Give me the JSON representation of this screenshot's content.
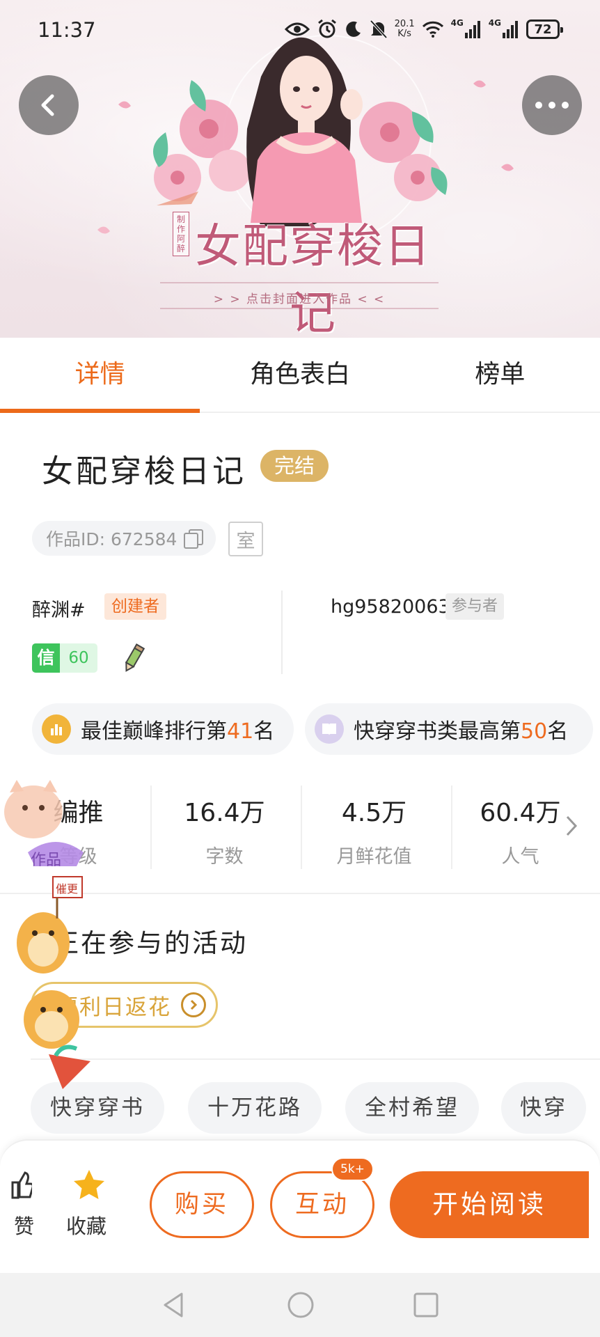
{
  "status_bar": {
    "time": "11:37",
    "net_speed_value": "20.1",
    "net_speed_unit": "K/s",
    "network_label_1": "4G",
    "network_label_2": "4G",
    "battery": "72"
  },
  "hero": {
    "title": "女配穿梭日记",
    "credit": "制作 阿醉",
    "hint": "> > 点击封面进入作品 < <"
  },
  "tabs": [
    {
      "label": "详情",
      "active": true
    },
    {
      "label": "角色表白",
      "active": false
    },
    {
      "label": "榜单",
      "active": false
    }
  ],
  "book": {
    "title": "女配穿梭日记",
    "status": "完结",
    "id_label": "作品ID: 672584",
    "room_label": "室"
  },
  "authors": {
    "creator_name": "醉渊#",
    "creator_tag": "创建者",
    "credit_label": "信",
    "credit_value": "60",
    "participant_name": "hg95820063",
    "participant_tag": "参与者"
  },
  "rankings": [
    {
      "prefix": "最佳巅峰排行第",
      "number": "41",
      "suffix": "名"
    },
    {
      "prefix": "快穿穿书类最高第",
      "number": "50",
      "suffix": "名"
    }
  ],
  "stats": [
    {
      "value": "编推",
      "label": "等级"
    },
    {
      "value": "16.4万",
      "label": "字数"
    },
    {
      "value": "4.5万",
      "label": "月鲜花值"
    },
    {
      "value": "60.4万",
      "label": "人气"
    }
  ],
  "activities": {
    "title": "正在参与的活动",
    "items": [
      "福利日返花"
    ]
  },
  "tags": [
    "快穿穿书",
    "十万花路",
    "全村希望",
    "快穿"
  ],
  "float_deco": {
    "sign_1": "作品",
    "sign_2": "催更"
  },
  "bottom_bar": {
    "like_label": "赞",
    "favorite_label": "收藏",
    "buy_label": "购买",
    "interact_label": "互动",
    "interact_badge": "5k+",
    "read_label": "开始阅读"
  },
  "colors": {
    "accent": "#ee6b20",
    "complete_badge": "#dcb466",
    "credit_green": "#3ec45c",
    "activity_gold": "#e6c46a"
  }
}
